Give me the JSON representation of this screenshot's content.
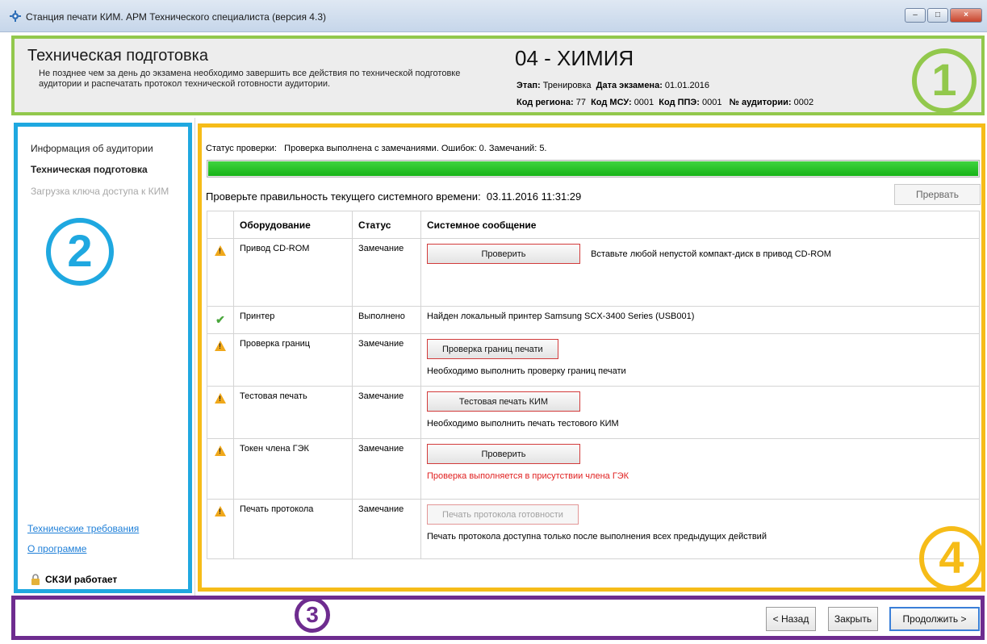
{
  "window": {
    "title": "Станция печати КИМ. АРМ Технического специалиста (версия 4.3)",
    "icon": "app-gear-icon",
    "buttons": [
      "–",
      "□",
      "×"
    ]
  },
  "header": {
    "title": "Техническая подготовка",
    "description": "Не позднее чем за день до экзамена необходимо завершить все действия по технической подготовке аудитории и распечатать протокол технической готовности аудитории.",
    "subject": "04 - ХИМИЯ",
    "stage_label": "Этап:",
    "stage_value": "Тренировка",
    "exam_date_label": "Дата экзамена:",
    "exam_date_value": "01.01.2016",
    "region_label": "Код региона:",
    "region_value": "77",
    "msu_label": "Код МСУ:",
    "msu_value": "0001",
    "ppe_label": "Код ППЭ:",
    "ppe_value": "0001",
    "room_label": "№ аудитории:",
    "room_value": "0002"
  },
  "sidebar": {
    "items": [
      {
        "label": "Информация об аудитории",
        "state": "normal"
      },
      {
        "label": "Техническая подготовка",
        "state": "active"
      },
      {
        "label": "Загрузка ключа доступа к КИМ",
        "state": "disabled"
      }
    ],
    "links": [
      "Технические требования",
      "О программе"
    ],
    "status": "СКЗИ работает"
  },
  "main": {
    "status_label": "Статус проверки:",
    "status_text": "Проверка выполнена с замечаниями. Ошибок: 0. Замечаний: 5.",
    "progress": 1.0,
    "time_label": "Проверьте правильность текущего системного времени:",
    "time_value": "03.11.2016 11:31:29",
    "abort_label": "Прервать",
    "columns": [
      "Оборудование",
      "Статус",
      "Системное сообщение"
    ],
    "rows": [
      {
        "icon": "warning-icon",
        "equipment": "Привод CD-ROM",
        "status": "Замечание",
        "button": "Проверить",
        "message": "Вставьте любой непустой компакт-диск в привод CD-ROM"
      },
      {
        "icon": "check-icon",
        "equipment": "Принтер",
        "status": "Выполнено",
        "message": "Найден локальный принтер Samsung SCX-3400 Series (USB001)"
      },
      {
        "icon": "warning-icon",
        "equipment": "Проверка границ",
        "status": "Замечание",
        "button": "Проверка границ печати",
        "message": "Необходимо выполнить проверку границ печати"
      },
      {
        "icon": "warning-icon",
        "equipment": "Тестовая печать",
        "status": "Замечание",
        "button": "Тестовая печать КИМ",
        "message": "Необходимо выполнить печать тестового КИМ"
      },
      {
        "icon": "warning-icon",
        "equipment": "Токен члена ГЭК",
        "status": "Замечание",
        "button": "Проверить",
        "message": "Проверка выполняется в присутствии члена ГЭК"
      },
      {
        "icon": "warning-icon",
        "equipment": "Печать протокола",
        "status": "Замечание",
        "button": "Печать протокола готовности",
        "message": "Печать протокола доступна только после выполнения всех предыдущих действий"
      }
    ]
  },
  "footer": {
    "back_label": "< Назад",
    "close_label": "Закрыть",
    "continue_label": "Продолжить >"
  },
  "callouts": [
    "1",
    "2",
    "3",
    "4"
  ],
  "colors": {
    "callout_1": "#92c84c",
    "callout_2": "#1fa8e0",
    "callout_3": "#6e2c8f",
    "callout_4": "#f6bc18",
    "progress": "#17b317",
    "warning_text": "#e02020"
  }
}
